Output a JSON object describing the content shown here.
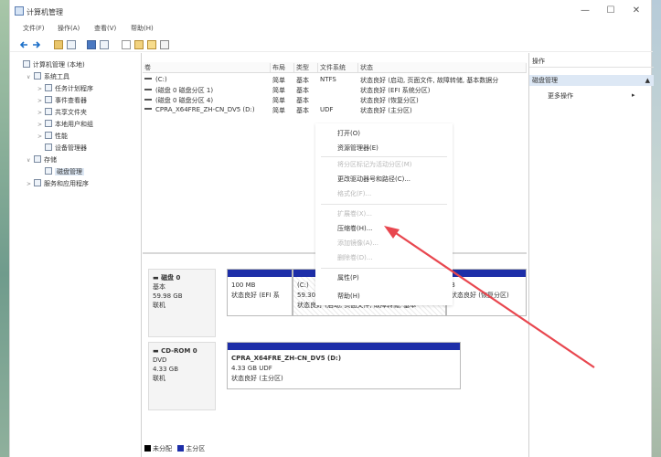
{
  "window": {
    "title": "计算机管理"
  },
  "menu": [
    "文件(F)",
    "操作(A)",
    "查看(V)",
    "帮助(H)"
  ],
  "tree": [
    {
      "label": "计算机管理 (本地)",
      "indent": 0,
      "arrow": ""
    },
    {
      "label": "系统工具",
      "indent": 1,
      "arrow": "∨"
    },
    {
      "label": "任务计划程序",
      "indent": 2,
      "arrow": ">"
    },
    {
      "label": "事件查看器",
      "indent": 2,
      "arrow": ">"
    },
    {
      "label": "共享文件夹",
      "indent": 2,
      "arrow": ">"
    },
    {
      "label": "本地用户和组",
      "indent": 2,
      "arrow": ">"
    },
    {
      "label": "性能",
      "indent": 2,
      "arrow": ">"
    },
    {
      "label": "设备管理器",
      "indent": 2,
      "arrow": ""
    },
    {
      "label": "存储",
      "indent": 1,
      "arrow": "∨"
    },
    {
      "label": "磁盘管理",
      "indent": 2,
      "arrow": "",
      "selected": true
    },
    {
      "label": "服务和应用程序",
      "indent": 1,
      "arrow": ">"
    }
  ],
  "volume_table": {
    "columns": [
      "卷",
      "布局",
      "类型",
      "文件系统",
      "状态"
    ],
    "rows": [
      [
        "(C:)",
        "简单",
        "基本",
        "NTFS",
        "状态良好 (启动, 页面文件, 故障转储, 基本数据分"
      ],
      [
        "(磁盘 0 磁盘分区 1)",
        "简单",
        "基本",
        "",
        "状态良好 (EFI 系统分区)"
      ],
      [
        "(磁盘 0 磁盘分区 4)",
        "简单",
        "基本",
        "",
        "状态良好 (恢复分区)"
      ],
      [
        "CPRA_X64FRE_ZH-CN_DV5 (D:)",
        "简单",
        "基本",
        "UDF",
        "状态良好 (主分区)"
      ]
    ]
  },
  "disks": [
    {
      "name": "磁盘 0",
      "type": "基本",
      "size": "59.98 GB",
      "status": "联机",
      "partitions": [
        {
          "line1": "",
          "line2": "100 MB",
          "line3": "状态良好 (EFI 系"
        },
        {
          "line1": "(C:)",
          "line2": "59.30 G",
          "line3": "状态良好 (启动, 页面文件, 故障转储, 基本"
        },
        {
          "line1": "",
          "line2": "",
          "line3": ""
        },
        {
          "line1": "",
          "line2": "B",
          "line3": "状态良好 (恢复分区)"
        }
      ]
    },
    {
      "name": "CD-ROM 0",
      "type": "DVD",
      "size": "4.33 GB",
      "status": "联机",
      "partitions": [
        {
          "line1": "CPRA_X64FRE_ZH-CN_DV5 (D:)",
          "line2": "4.33 GB UDF",
          "line3": "状态良好 (主分区)"
        }
      ]
    }
  ],
  "legend": [
    "未分配",
    "主分区"
  ],
  "actions": {
    "header": "操作",
    "selected": "磁盘管理",
    "more": "更多操作"
  },
  "context_menu": [
    {
      "label": "打开(O)",
      "disabled": false
    },
    {
      "label": "资源管理器(E)",
      "disabled": false
    },
    {
      "label": "将分区标记为活动分区(M)",
      "disabled": true
    },
    {
      "label": "更改驱动器号和路径(C)...",
      "disabled": false
    },
    {
      "label": "格式化(F)...",
      "disabled": true
    },
    {
      "label": "扩展卷(X)...",
      "disabled": true
    },
    {
      "label": "压缩卷(H)...",
      "disabled": false
    },
    {
      "label": "添加镜像(A)...",
      "disabled": true
    },
    {
      "label": "删除卷(D)...",
      "disabled": true
    },
    {
      "label": "属性(P)",
      "disabled": false
    },
    {
      "label": "帮助(H)",
      "disabled": false
    }
  ],
  "colors": {
    "primary_partition": "#1d2ea8",
    "unallocated": "#000000",
    "annotation_arrow": "#e8474f",
    "selection": "#dde8f5"
  }
}
